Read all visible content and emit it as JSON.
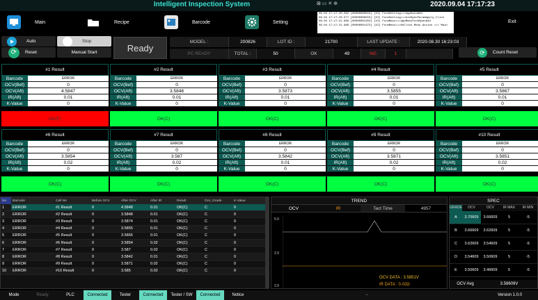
{
  "header": {
    "title": "Intelligent Inspection System",
    "datetime": "2020.09.04 17:17:23",
    "window_controls": "⊠ ▭ ✕ ⊕"
  },
  "toolbar": {
    "main": "Main",
    "recipe": "Recipe",
    "barcode": "Barcode",
    "setting": "Setting",
    "exit": "Exit"
  },
  "log_lines": [
    "09-04 17:17:20.582 [00000000015] [UI] FormSetting==>dgvAutoAdd",
    "09-04 17:17:20.577 [00000000015] [UI] FormSetting==>btnSpecParamApply_Click",
    "09-04 17:17:21.969 [00000001352] [UI] FormMain==>dgvMainFormSpecAdd",
    "09-04 17:17:21.986 [00000001372] [UI] FormMain==>OnClick.Menu   Action ==> Main"
  ],
  "controls": {
    "auto": "Auto",
    "stop": "Stop",
    "reset": "Reset",
    "manual_start": "Manual Start",
    "ready": "Ready",
    "count_reset": "Count Reset"
  },
  "info": {
    "model_label": "MODEL :",
    "model": "200826",
    "lotid_label": "LOT ID :",
    "lotid": "21700",
    "lastupdate_label": "LAST UPDATE :",
    "lastupdate": "2020.08.30 16:23:03",
    "pcready": "PC READY",
    "total_label": "TOTAL :",
    "total": "50",
    "ok_label": "OK",
    "ok": "49",
    "ng_label": "NG",
    "ng": "1"
  },
  "card_labels": {
    "barcode": "Barcode",
    "ocv_bef": "OCV(Bef)",
    "ocv_aft": "OCV(Aft)",
    "ir_aft": "IR(Aft)",
    "kvalue": "K-Value"
  },
  "cards": [
    {
      "title": "#1 Result",
      "barcode": "ERROR",
      "ocv_bef": "0",
      "ocv_aft": "4.5847",
      "ir_aft": "0.01",
      "kvalue": "0",
      "status": "NG(F)",
      "ok": false
    },
    {
      "title": "#2 Result",
      "barcode": "ERROR",
      "ocv_bef": "0",
      "ocv_aft": "3.5848",
      "ir_aft": "0.01",
      "kvalue": "0",
      "status": "OK(C)",
      "ok": true
    },
    {
      "title": "#3 Result",
      "barcode": "ERROR",
      "ocv_bef": "0",
      "ocv_aft": "3.5873",
      "ir_aft": "0.01",
      "kvalue": "0",
      "status": "OK(C)",
      "ok": true
    },
    {
      "title": "#4 Result",
      "barcode": "ERROR",
      "ocv_bef": "0",
      "ocv_aft": "3.5855",
      "ir_aft": "0.01",
      "kvalue": "0",
      "status": "OK(C)",
      "ok": true
    },
    {
      "title": "#5 Result",
      "barcode": "ERROR",
      "ocv_bef": "0",
      "ocv_aft": "3.5867",
      "ir_aft": "0.01",
      "kvalue": "0",
      "status": "OK(C)",
      "ok": true
    },
    {
      "title": "#6 Result",
      "barcode": "ERROR",
      "ocv_bef": "0",
      "ocv_aft": "3.5854",
      "ir_aft": "0.02",
      "kvalue": "0",
      "status": "OK(C)",
      "ok": true
    },
    {
      "title": "#7 Result",
      "barcode": "ERROR",
      "ocv_bef": "0",
      "ocv_aft": "3.587",
      "ir_aft": "0.02",
      "kvalue": "0",
      "status": "OK(C)",
      "ok": true
    },
    {
      "title": "#8 Result",
      "barcode": "ERROR",
      "ocv_bef": "0",
      "ocv_aft": "3.5842",
      "ir_aft": "0.01",
      "kvalue": "0",
      "status": "OK(C)",
      "ok": true
    },
    {
      "title": "#9 Result",
      "barcode": "ERROR",
      "ocv_bef": "0",
      "ocv_aft": "3.5871",
      "ir_aft": "0.02",
      "kvalue": "0",
      "status": "OK(C)",
      "ok": true
    },
    {
      "title": "#10 Result",
      "barcode": "ERROR",
      "ocv_bef": "0",
      "ocv_aft": "3.5851",
      "ir_aft": "0.02",
      "kvalue": "0",
      "status": "OK(C)",
      "ok": true
    }
  ],
  "table": {
    "headers": [
      "No",
      "Barcode",
      "Cell No",
      "Before OCV",
      "After OCV",
      "After IR",
      "Result",
      "Ocv_Grade",
      "K-Value"
    ],
    "rows": [
      [
        "1",
        "ERROR",
        "#1 Result",
        "0",
        "4.5848",
        "0.01",
        "OK(C)",
        "C",
        "0"
      ],
      [
        "2",
        "ERROR",
        "#2 Result",
        "0",
        "3.5848",
        "0.01",
        "OK(C)",
        "C",
        "0"
      ],
      [
        "3",
        "ERROR",
        "#3 Result",
        "0",
        "3.5874",
        "0.01",
        "OK(C)",
        "C",
        "0"
      ],
      [
        "4",
        "ERROR",
        "#4 Result",
        "0",
        "3.5855",
        "0.01",
        "OK(C)",
        "C",
        "0"
      ],
      [
        "5",
        "ERROR",
        "#5 Result",
        "0",
        "3.5866",
        "0.01",
        "OK(C)",
        "C",
        "0"
      ],
      [
        "6",
        "ERROR",
        "#6 Result",
        "0",
        "3.5854",
        "0.02",
        "OK(C)",
        "C",
        "0"
      ],
      [
        "7",
        "ERROR",
        "#7 Result",
        "0",
        "3.587",
        "0.02",
        "OK(C)",
        "C",
        "0"
      ],
      [
        "8",
        "ERROR",
        "#8 Result",
        "0",
        "3.5842",
        "0.01",
        "OK(C)",
        "C",
        "0"
      ],
      [
        "9",
        "ERROR",
        "#9 Result",
        "0",
        "3.5871",
        "0.02",
        "OK(C)",
        "C",
        "0"
      ],
      [
        "10",
        "ERROR",
        "#10 Result",
        "0",
        "3.585",
        "0.02",
        "OK(C)",
        "C",
        "0"
      ]
    ]
  },
  "trend": {
    "title": "TREND",
    "ocv_label": "OCV",
    "ir_label": "IR",
    "tact_label": "Tact Time",
    "tact": "4957",
    "ytop": "5.0",
    "ymid": "2.0",
    "ybot": "2.0",
    "ocv_data": "OCV DATA : 3.5851V",
    "ir_data": "IR DATA : 0.02Ω"
  },
  "spec": {
    "title": "SPEC",
    "headers": [
      "GRADE",
      "OCV",
      "OCV",
      "IR MAX",
      "IR MIN"
    ],
    "rows": [
      [
        "A",
        "3.70609",
        "3.66609",
        "5",
        "-5"
      ],
      [
        "B",
        "3.66609",
        "3.62609",
        "5",
        "-5"
      ],
      [
        "C",
        "3.62609",
        "3.54609",
        "5",
        "-5"
      ],
      [
        "D",
        "3.54609",
        "3.50609",
        "5",
        "-5"
      ],
      [
        "E",
        "3.50609",
        "3.46609",
        "5",
        "-5"
      ]
    ],
    "avg_label": "OCV Avg",
    "avg": "3.58609V"
  },
  "footer": {
    "mode": "Mode",
    "mode_val": "Ready",
    "plc": "PLC",
    "plc_val": "Connected",
    "tester": "Tester",
    "tester_val": "Connected",
    "tester_sw": "Tester / SW",
    "tester_sw_val": "Connected",
    "notice": "Notice",
    "notice_val": "-",
    "version": "Version 1.0.0"
  },
  "colors": {
    "teal": "#0d5a52",
    "accent": "#39e0d0",
    "ok": "#00ff40",
    "ng": "#ff0000"
  }
}
